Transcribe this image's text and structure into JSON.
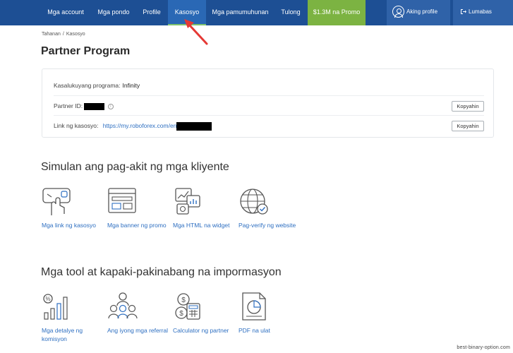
{
  "nav": {
    "items": [
      {
        "label": "Mga account"
      },
      {
        "label": "Mga pondo"
      },
      {
        "label": "Profile"
      },
      {
        "label": "Kasosyo"
      },
      {
        "label": "Mga pamumuhunan"
      },
      {
        "label": "Tulong"
      },
      {
        "label": "$1.3M na Promo"
      }
    ],
    "profile_label": "Aking profile",
    "logout_label": "Lumabas"
  },
  "breadcrumb": {
    "home": "Tahanan",
    "sep": "/",
    "current": "Kasosyo"
  },
  "page_title": "Partner Program",
  "card": {
    "program_label": "Kasalukuyang programa:",
    "program_value": "Infinity",
    "partner_id_label": "Partner ID:",
    "info_icon_glyph": "i",
    "link_label": "Link ng kasosyo:",
    "link_value": "https://my.roboforex.com/en",
    "copy_label": "Kopyahin"
  },
  "section1": {
    "title": "Simulan ang pag-akit ng mga kliyente",
    "tiles": [
      {
        "label": "Mga link ng kasosyo",
        "icon": "hand-link-icon"
      },
      {
        "label": "Mga banner ng promo",
        "icon": "banner-icon"
      },
      {
        "label": "Mga HTML na widget",
        "icon": "widget-icon"
      },
      {
        "label": "Pag-verify ng website",
        "icon": "globe-check-icon"
      }
    ]
  },
  "section2": {
    "title": "Mga tool at kapaki-pakinabang na impormasyon",
    "tiles": [
      {
        "label": "Mga detalye ng komisyon",
        "icon": "commission-chart-icon"
      },
      {
        "label": "Ang iyong mga referral",
        "icon": "referrals-group-icon"
      },
      {
        "label": "Calculator ng partner",
        "icon": "calculator-coins-icon"
      },
      {
        "label": "PDF na ulat",
        "icon": "pdf-report-icon"
      }
    ]
  },
  "watermark": "best-binary-option.com",
  "colors": {
    "nav_bg": "#1d4f94",
    "nav_active": "#2a68b5",
    "promo": "#7cb342",
    "link": "#2e6fc1",
    "annotation": "#e53935"
  }
}
